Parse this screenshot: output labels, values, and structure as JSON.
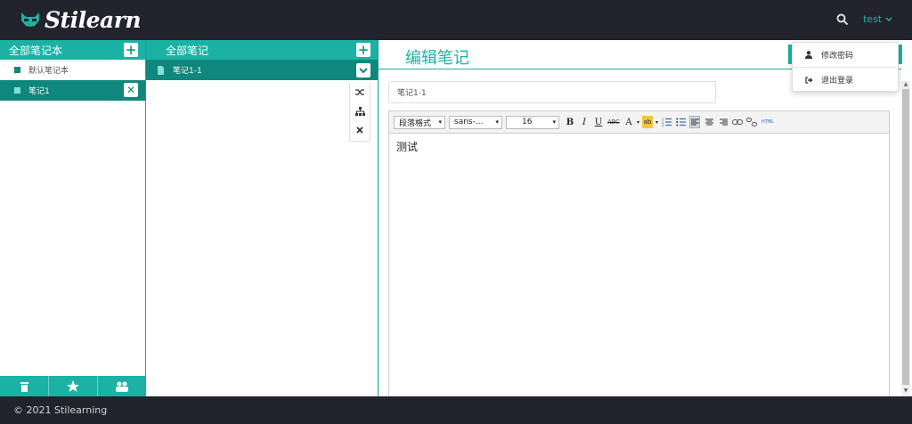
{
  "app": {
    "logo_text": "Stilearn"
  },
  "header": {
    "search_icon": "search-icon",
    "user_label": "test"
  },
  "notebooks": {
    "header_label": "全部笔记本",
    "items": [
      {
        "label": "默认笔记本",
        "active": false
      },
      {
        "label": "笔记1",
        "active": true
      }
    ],
    "footer_icons": [
      "trash-icon",
      "star-icon",
      "users-icon"
    ]
  },
  "notes": {
    "header_label": "全部笔记",
    "items": [
      {
        "label": "笔记1-1",
        "active": true
      }
    ],
    "actions": [
      "shuffle-icon",
      "sitemap-icon",
      "close-icon"
    ]
  },
  "editor": {
    "title": "编辑笔记",
    "note_title_value": "笔记1-1",
    "toolbar": {
      "paragraph": "段落格式",
      "font": "sans-...",
      "size": "16",
      "bold": "B",
      "italic": "I",
      "underline": "U",
      "strike": "ABC",
      "font_color": "A",
      "highlight": "ab",
      "html": "HTML"
    },
    "content": "测试"
  },
  "user_menu": {
    "items": [
      {
        "label": "修改密码",
        "icon": "user-icon"
      },
      {
        "label": "退出登录",
        "icon": "logout-icon"
      }
    ]
  },
  "footer": {
    "copyright": "© 2021 Stilearning"
  },
  "colors": {
    "accent": "#1bb2a4",
    "accent_dark": "#0f877c",
    "topbar": "#23232e"
  }
}
